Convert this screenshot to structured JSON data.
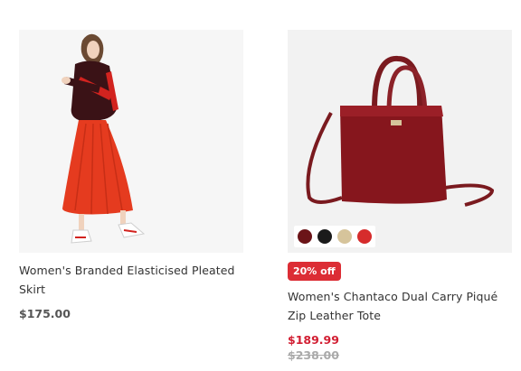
{
  "products": [
    {
      "title": "Women's Branded Elasticised Pleated Skirt",
      "price": "$175.00",
      "image_icon": "woman-red-pleated-skirt-image"
    },
    {
      "badge": "20% off",
      "title": "Women's Chantaco Dual Carry Piqué Zip Leather Tote",
      "price": "$189.99",
      "old_price": "$238.00",
      "image_icon": "burgundy-leather-tote-image",
      "swatches": [
        "#6b1418",
        "#1b1b1b",
        "#d6c49b",
        "#d62c2c"
      ]
    }
  ]
}
